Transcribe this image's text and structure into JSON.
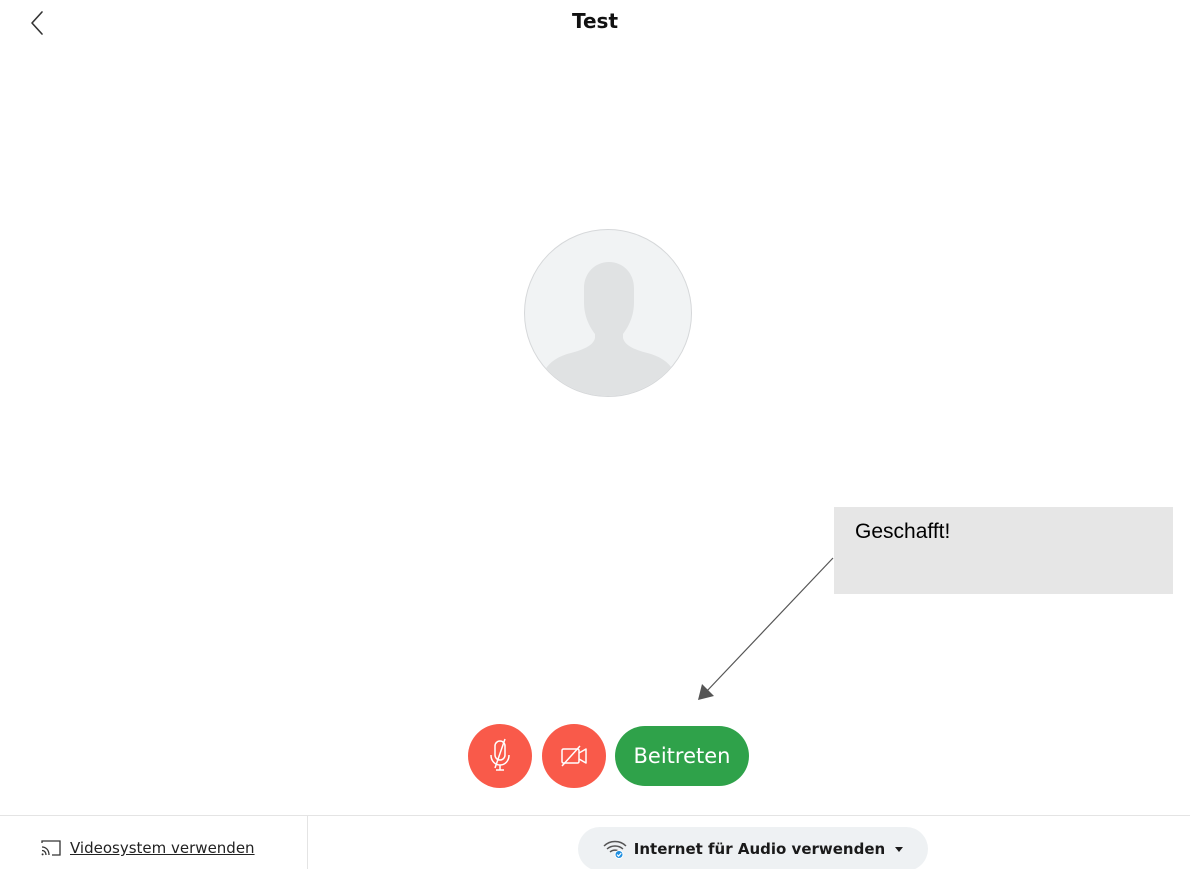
{
  "header": {
    "title": "Test",
    "back_icon": "chevron-left-icon"
  },
  "avatar": {
    "icon": "person-silhouette-icon"
  },
  "callout": {
    "text": "Geschafft!"
  },
  "controls": {
    "mute_icon": "microphone-muted-icon",
    "video_icon": "camera-off-icon",
    "join_label": "Beitreten",
    "colors": {
      "mute_bg": "#f95a4a",
      "video_bg": "#f95a4a",
      "join_bg": "#2fa24a"
    }
  },
  "bottom_bar": {
    "video_system_label": "Videosystem verwenden",
    "video_system_icon": "cast-icon",
    "audio_label": "Internet für Audio verwenden",
    "audio_icon": "wifi-icon",
    "audio_dropdown_icon": "caret-down-icon"
  }
}
